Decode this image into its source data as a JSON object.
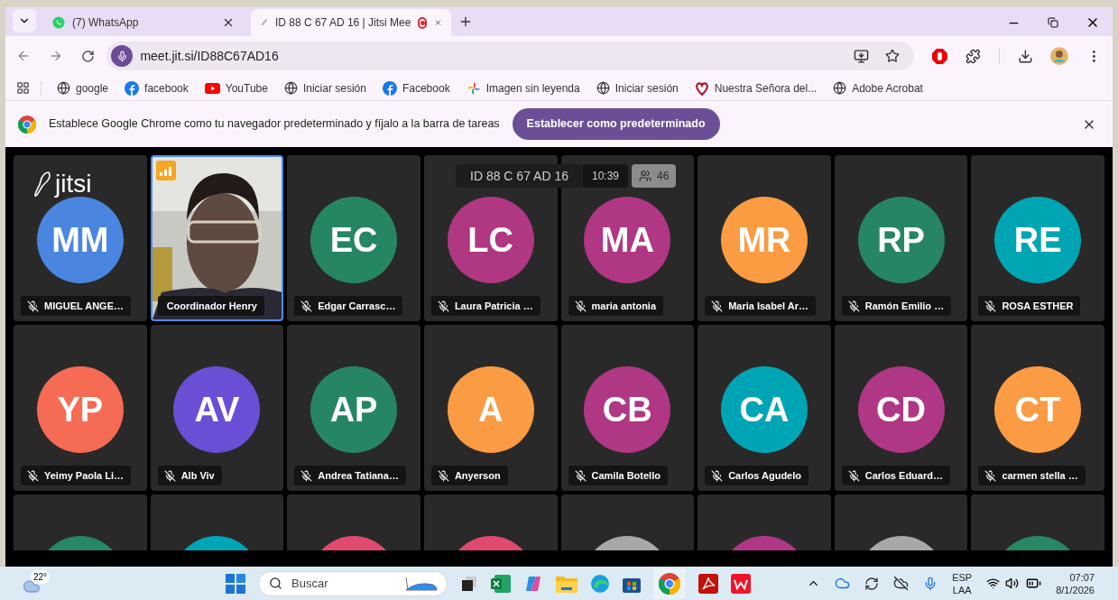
{
  "browser_tabs": [
    {
      "title": "(7) WhatsApp",
      "kind": "whatsapp",
      "selected": false
    },
    {
      "title": "ID 88 C 67 AD 16 | Jitsi Mee",
      "kind": "jitsi",
      "selected": true
    }
  ],
  "address": "meet.jit.si/ID88C67AD16",
  "bookmarks": [
    {
      "label": "google",
      "kind": "globe"
    },
    {
      "label": "facebook",
      "kind": "facebook"
    },
    {
      "label": "YouTube",
      "kind": "youtube"
    },
    {
      "label": "Iniciar sesión",
      "kind": "globe"
    },
    {
      "label": "Facebook",
      "kind": "facebook"
    },
    {
      "label": "Imagen sin leyenda",
      "kind": "photos"
    },
    {
      "label": "Iniciar sesión",
      "kind": "globe"
    },
    {
      "label": "Nuestra Señora del...",
      "kind": "heart"
    },
    {
      "label": "Adobe Acrobat",
      "kind": "globe"
    }
  ],
  "infobar": {
    "message": "Establece Google Chrome como tu navegador predeterminado y fíjalo a la barra de tareas",
    "button": "Establecer como predeterminado"
  },
  "meeting": {
    "logo": "jitsi",
    "room_id": "ID 88 C 67 AD 16",
    "time": "10:39",
    "participant_count": "46"
  },
  "participants": [
    {
      "kind": "avatar",
      "initials": "MM",
      "name": "MIGUEL ANGE…",
      "color": "#4a86e0",
      "muted": true,
      "selected": false
    },
    {
      "kind": "video",
      "name": "Coordinador Henry",
      "muted": false,
      "selected": true
    },
    {
      "kind": "avatar",
      "initials": "EC",
      "name": "Edgar Carrasc…",
      "color": "#268662",
      "muted": true,
      "selected": false
    },
    {
      "kind": "avatar",
      "initials": "LC",
      "name": "Laura Patricia …",
      "color": "#b03782",
      "muted": true,
      "selected": false
    },
    {
      "kind": "avatar",
      "initials": "MA",
      "name": "maria antonia",
      "color": "#b03783",
      "muted": true,
      "selected": false
    },
    {
      "kind": "avatar",
      "initials": "MR",
      "name": "Maria Isabel Ar…",
      "color": "#fb9b42",
      "muted": true,
      "selected": false
    },
    {
      "kind": "avatar",
      "initials": "RP",
      "name": "Ramón Emilio …",
      "color": "#268663",
      "muted": true,
      "selected": false
    },
    {
      "kind": "avatar",
      "initials": "RE",
      "name": "ROSA ESTHER",
      "color": "#00a5b4",
      "muted": true,
      "selected": false
    },
    {
      "kind": "avatar",
      "initials": "YP",
      "name": "Yeimy Paola Li…",
      "color": "#f66b54",
      "muted": true,
      "selected": false
    },
    {
      "kind": "avatar",
      "initials": "AV",
      "name": "Alb Viv",
      "color": "#6a4fd6",
      "muted": true,
      "selected": false
    },
    {
      "kind": "avatar",
      "initials": "AP",
      "name": "Andrea Tatiana…",
      "color": "#268664",
      "muted": true,
      "selected": false
    },
    {
      "kind": "avatar",
      "initials": "A",
      "name": "Anyerson",
      "color": "#fb9b43",
      "muted": true,
      "selected": false
    },
    {
      "kind": "avatar",
      "initials": "CB",
      "name": "Camila Botello",
      "color": "#b03784",
      "muted": true,
      "selected": false
    },
    {
      "kind": "avatar",
      "initials": "CA",
      "name": "Carlos Agudelo",
      "color": "#00a5b5",
      "muted": true,
      "selected": false
    },
    {
      "kind": "avatar",
      "initials": "CD",
      "name": "Carlos Eduard…",
      "color": "#b03785",
      "muted": true,
      "selected": false
    },
    {
      "kind": "avatar",
      "initials": "CT",
      "name": "carmen stella …",
      "color": "#fb9b44",
      "muted": true,
      "selected": false
    },
    {
      "kind": "avatar",
      "color": "#268665",
      "selected": false
    },
    {
      "kind": "avatar",
      "color": "#00a5b6",
      "selected": false
    },
    {
      "kind": "avatar",
      "color": "#e04a6e",
      "selected": false
    },
    {
      "kind": "avatar",
      "color": "#e04a6f",
      "selected": false
    },
    {
      "kind": "avatar",
      "color": "#a8a8a8",
      "selected": false
    },
    {
      "kind": "avatar",
      "color": "#b03786",
      "selected": false
    },
    {
      "kind": "avatar",
      "color": "#a8a8a9",
      "selected": false
    },
    {
      "kind": "avatar",
      "color": "#268666",
      "selected": false
    }
  ],
  "taskbar": {
    "weather": "22°",
    "search_placeholder": "Buscar",
    "language": "ESP",
    "region": "LAA",
    "time": "07:07",
    "date": "8/1/2026"
  }
}
